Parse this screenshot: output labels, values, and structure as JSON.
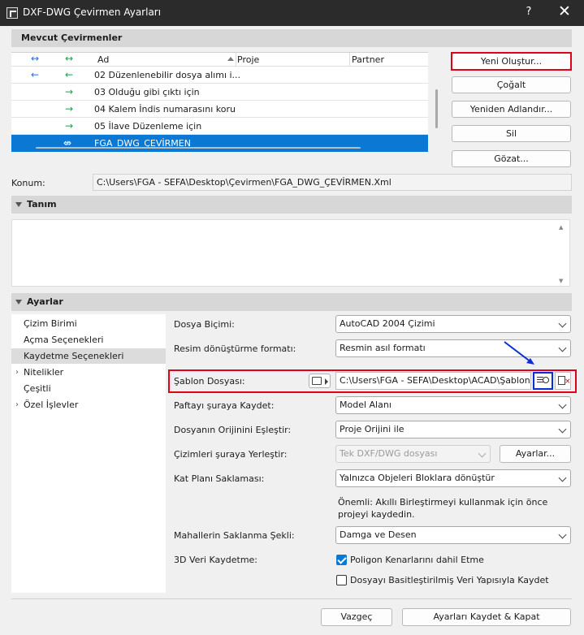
{
  "window": {
    "title": "DXF-DWG Çevirmen Ayarları",
    "help": "?",
    "close": "✕"
  },
  "translators": {
    "header": "Mevcut Çevirmenler",
    "columns": {
      "name": "Ad",
      "project": "Proje",
      "partner": "Partner"
    },
    "header_icons": {
      "col1": "↔",
      "col2": "↔"
    },
    "rows": [
      {
        "icon1": "←",
        "icon2": "←",
        "name": "02 Düzenlenebilir dosya alımı i..."
      },
      {
        "icon1": "",
        "icon2": "→",
        "name": "03 Olduğu gibi çıktı için"
      },
      {
        "icon1": "",
        "icon2": "→",
        "name": "04 Kalem İndis numarasını koru"
      },
      {
        "icon1": "",
        "icon2": "→",
        "name": "05 İlave Düzenleme için"
      },
      {
        "icon1": "",
        "icon2": "⇎",
        "name": "FGA_DWG_ÇEVİRMEN",
        "selected": true
      }
    ],
    "buttons": {
      "new": "Yeni Oluştur...",
      "duplicate": "Çoğalt",
      "rename": "Yeniden Adlandır...",
      "delete": "Sil",
      "browse": "Gözat..."
    }
  },
  "location": {
    "label": "Konum:",
    "value": "C:\\Users\\FGA - SEFA\\Desktop\\Çevirmen\\FGA_DWG_ÇEVİRMEN.Xml"
  },
  "description": {
    "header": "Tanım",
    "text": ""
  },
  "settings": {
    "header": "Ayarlar",
    "nav": [
      {
        "label": "Çizim Birimi"
      },
      {
        "label": "Açma Seçenekleri"
      },
      {
        "label": "Kaydetme Seçenekleri",
        "selected": true
      },
      {
        "label": "Nitelikler",
        "expandable": true
      },
      {
        "label": "Çeşitli"
      },
      {
        "label": "Özel İşlevler",
        "expandable": true
      }
    ],
    "file_format": {
      "label": "Dosya Biçimi:",
      "value": "AutoCAD 2004 Çizimi"
    },
    "image_format": {
      "label": "Resim dönüştürme formatı:",
      "value": "Resmin asıl formatı"
    },
    "template": {
      "label": "Şablon Dosyası:",
      "value": "C:\\Users\\FGA - SEFA\\Desktop\\ACAD\\Şablon.dwt"
    },
    "save_sheet": {
      "label": "Paftayı şuraya Kaydet:",
      "value": "Model Alanı"
    },
    "origin": {
      "label": "Dosyanın Orijinini Eşleştir:",
      "value": "Proje Orijini ile"
    },
    "place_drawings": {
      "label": "Çizimleri şuraya Yerleştir:",
      "value": "Tek DXF/DWG dosyası",
      "button": "Ayarlar..."
    },
    "floor_plan": {
      "label": "Kat Planı Saklaması:",
      "value": "Yalnızca Objeleri Bloklara dönüştür",
      "note": "Önemli: Akıllı Birleştirmeyi kullanmak için önce projeyi kaydedin."
    },
    "zones": {
      "label": "Mahallerin Saklanma Şekli:",
      "value": "Damga ve Desen"
    },
    "data3d": {
      "label": "3D Veri Kaydetme:",
      "option1": "Poligon Kenarlarını dahil Etme",
      "option1_checked": true,
      "option2": "Dosyayı Basitleştirilmiş Veri Yapısıyla Kaydet",
      "option2_checked": false
    }
  },
  "footer": {
    "cancel": "Vazgeç",
    "save": "Ayarları Kaydet & Kapat"
  },
  "colors": {
    "selection": "#0b78d4",
    "highlight_red": "#e0001a",
    "highlight_blue": "#0a2fd6"
  }
}
